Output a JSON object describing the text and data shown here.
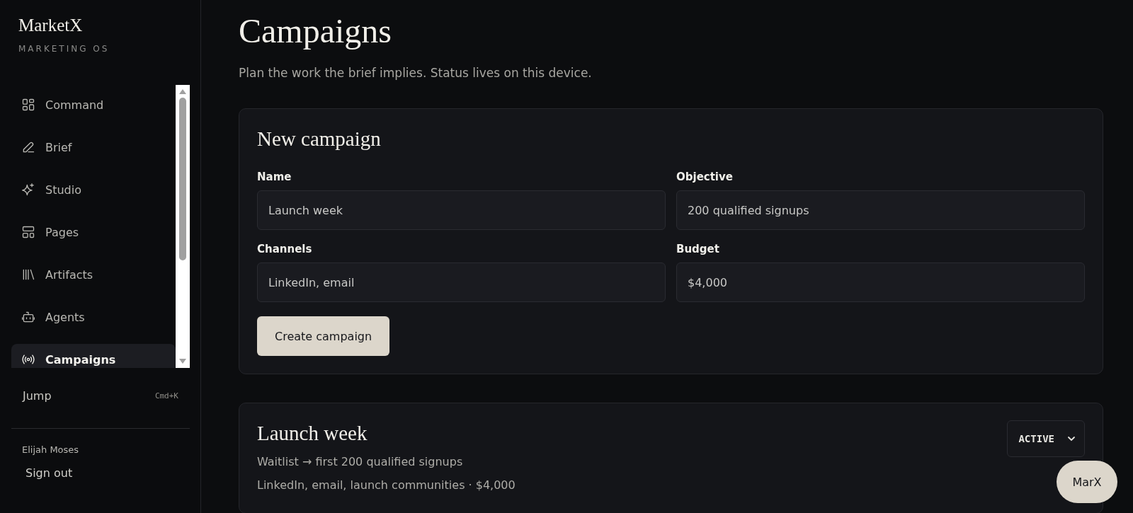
{
  "brand": {
    "name": "MarketX",
    "tagline": "MARKETING OS"
  },
  "nav": [
    {
      "label": "Command",
      "selected": false
    },
    {
      "label": "Brief",
      "selected": false
    },
    {
      "label": "Studio",
      "selected": false
    },
    {
      "label": "Pages",
      "selected": false
    },
    {
      "label": "Artifacts",
      "selected": false
    },
    {
      "label": "Agents",
      "selected": false
    },
    {
      "label": "Campaigns",
      "selected": true
    }
  ],
  "jump": {
    "label": "Jump",
    "shortcut": "Cmd+K"
  },
  "user": {
    "name": "Elijah Moses",
    "sign_out": "Sign out"
  },
  "page": {
    "title": "Campaigns",
    "subtitle": "Plan the work the brief implies. Status lives on this device."
  },
  "form": {
    "title": "New campaign",
    "fields": [
      {
        "label": "Name",
        "value": "Launch week"
      },
      {
        "label": "Objective",
        "value": "200 qualified signups"
      },
      {
        "label": "Channels",
        "value": "LinkedIn, email"
      },
      {
        "label": "Budget",
        "value": "$4,000"
      }
    ],
    "submit": "Create campaign"
  },
  "campaigns": [
    {
      "name": "Launch week",
      "objective": "Waitlist → first 200 qualified signups",
      "details": "LinkedIn, email, launch communities · $4,000",
      "status": "ACTIVE"
    }
  ],
  "assistant": {
    "label": "MarX"
  }
}
